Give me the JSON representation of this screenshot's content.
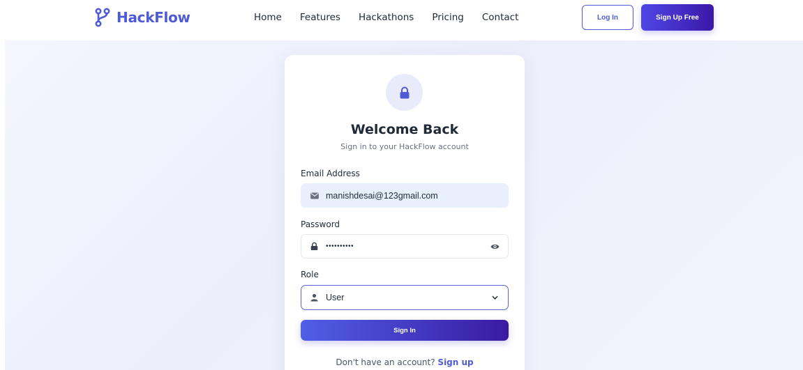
{
  "brand": {
    "name": "HackFlow",
    "color": "#4f5bd5"
  },
  "nav": {
    "items": [
      {
        "label": "Home"
      },
      {
        "label": "Features"
      },
      {
        "label": "Hackathons"
      },
      {
        "label": "Pricing"
      },
      {
        "label": "Contact"
      }
    ],
    "login_label": "Log In",
    "signup_label": "Sign Up Free"
  },
  "card": {
    "icon": "lock-icon",
    "title": "Welcome Back",
    "subtitle": "Sign in to your HackFlow account",
    "email": {
      "label": "Email Address",
      "value": "manishdesai@123gmail.com",
      "icon": "envelope-icon"
    },
    "password": {
      "label": "Password",
      "masked_value": "••••••••••",
      "icon": "lock-icon",
      "toggle_icon": "eye-icon"
    },
    "role": {
      "label": "Role",
      "selected": "User",
      "icon": "user-icon"
    },
    "submit_label": "Sign In",
    "footer": {
      "prompt": "Don't have an account?",
      "link": "Sign up"
    }
  },
  "colors": {
    "accent": "#4f5bd5",
    "gradient_start": "#4f46e5",
    "gradient_end": "#3b18a8"
  }
}
